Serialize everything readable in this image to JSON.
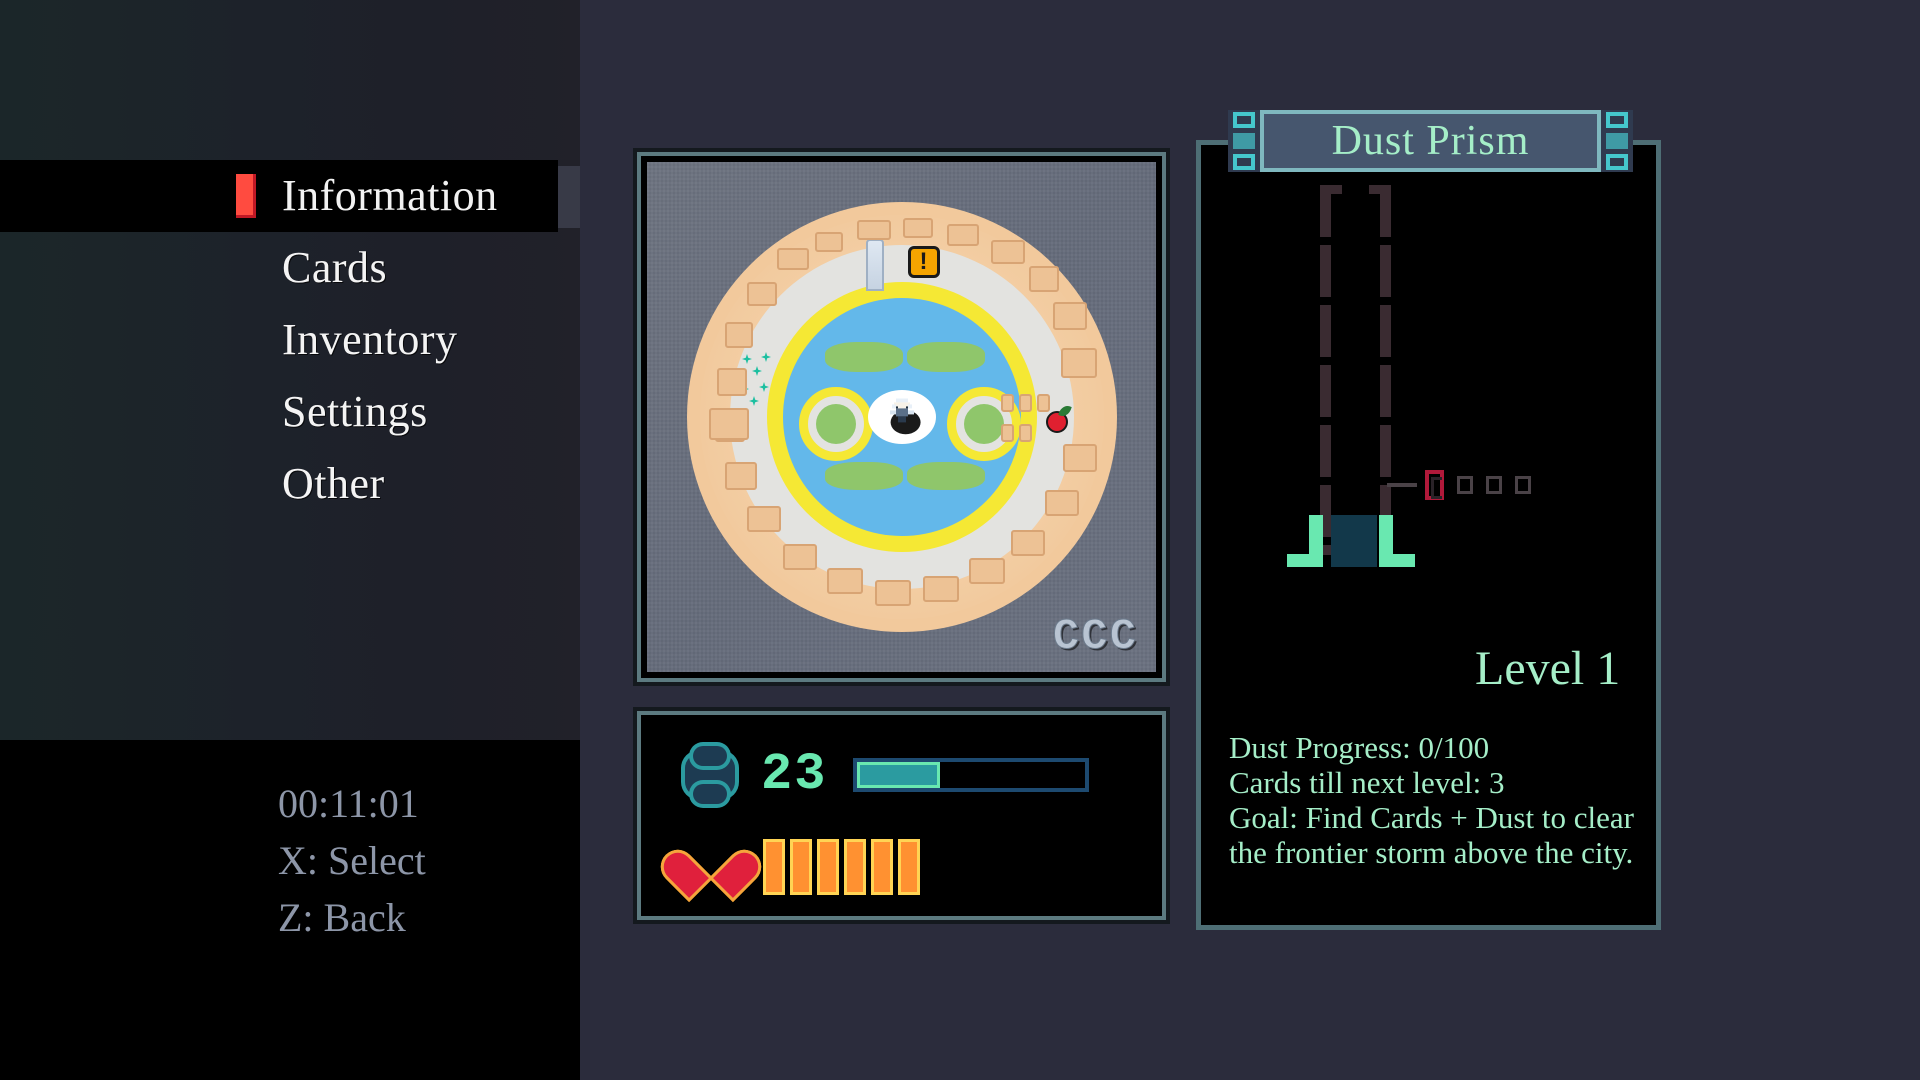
{
  "menu": {
    "items": [
      {
        "label": "Information",
        "selected": true
      },
      {
        "label": "Cards",
        "selected": false
      },
      {
        "label": "Inventory",
        "selected": false
      },
      {
        "label": "Settings",
        "selected": false
      },
      {
        "label": "Other",
        "selected": false
      }
    ]
  },
  "hints": {
    "timer": "00:11:01",
    "select": "X: Select",
    "back": "Z: Back"
  },
  "minimap": {
    "area_code": "CCC",
    "markers": {
      "quest_icon": "exclamation-marker",
      "item_icon": "apple-pickup",
      "landmark_icon": "tower",
      "sparkle_icon": "sparkle-cluster",
      "player_icon": "player-sprite"
    }
  },
  "stats": {
    "dust_icon": "dust-cloud-icon",
    "dust_count": "23",
    "dust_bar_percent": 36,
    "health_icon": "heart-icon",
    "health_pips": 6
  },
  "prism": {
    "title": "Dust Prism",
    "level": "Level 1",
    "slots_total": 4,
    "slots_active_index": 0,
    "info": [
      "Dust Progress: 0/100",
      "Cards till next level: 3",
      "Goal: Find Cards + Dust to clear",
      "the frontier storm above the city."
    ]
  },
  "colors": {
    "accent_mint": "#a5eec8",
    "accent_teal": "#2b9ba0",
    "selection_red": "#ff4b40",
    "slot_active_red": "#b0193a",
    "panel_border": "#4e6e75",
    "background": "#2b2c3c"
  }
}
